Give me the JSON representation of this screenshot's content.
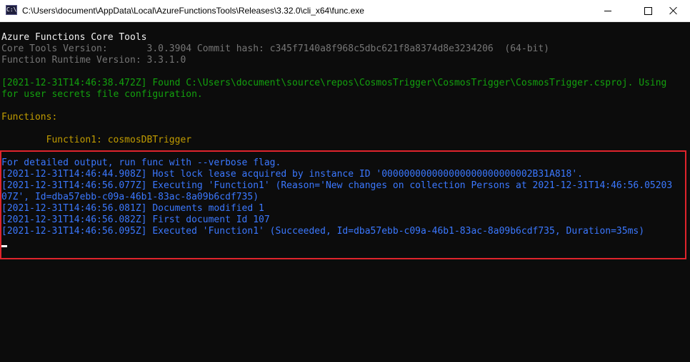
{
  "window": {
    "title": "C:\\Users\\document\\AppData\\Local\\AzureFunctionsTools\\Releases\\3.32.0\\cli_x64\\func.exe",
    "app_icon_text": "C:\\"
  },
  "console": {
    "l1": "Azure Functions Core Tools",
    "l2": "Core Tools Version:       3.0.3904 Commit hash: c345f7140a8f968c5dbc621f8a8374d8e3234206  (64-bit)",
    "l3": "Function Runtime Version: 3.3.1.0",
    "l4": "[2021-12-31T14:46:38.472Z] Found C:\\Users\\document\\source\\repos\\CosmosTrigger\\CosmosTrigger\\CosmosTrigger.csproj. Using",
    "l5": "for user secrets file configuration.",
    "l6": "Functions:",
    "l7": "        Function1: cosmosDBTrigger",
    "l8": "For detailed output, run func with --verbose flag.",
    "l9": "[2021-12-31T14:46:44.908Z] Host lock lease acquired by instance ID '000000000000000000000000002B31A818'.",
    "l10": "[2021-12-31T14:46:56.077Z] Executing 'Function1' (Reason='New changes on collection Persons at 2021-12-31T14:46:56.05203",
    "l11": "07Z', Id=dba57ebb-c09a-46b1-83ac-8a09b6cdf735)",
    "l12": "[2021-12-31T14:46:56.081Z] Documents modified 1",
    "l13": "[2021-12-31T14:46:56.082Z] First document Id 107",
    "l14": "[2021-12-31T14:46:56.095Z] Executed 'Function1' (Succeeded, Id=dba57ebb-c09a-46b1-83ac-8a09b6cdf735, Duration=35ms)"
  },
  "colors": {
    "background": "#0c0c0c",
    "highlight_border": "#e0242c",
    "green": "#13a10e",
    "yellow": "#c19c00",
    "blue": "#3b78ff",
    "gray": "#767676"
  }
}
